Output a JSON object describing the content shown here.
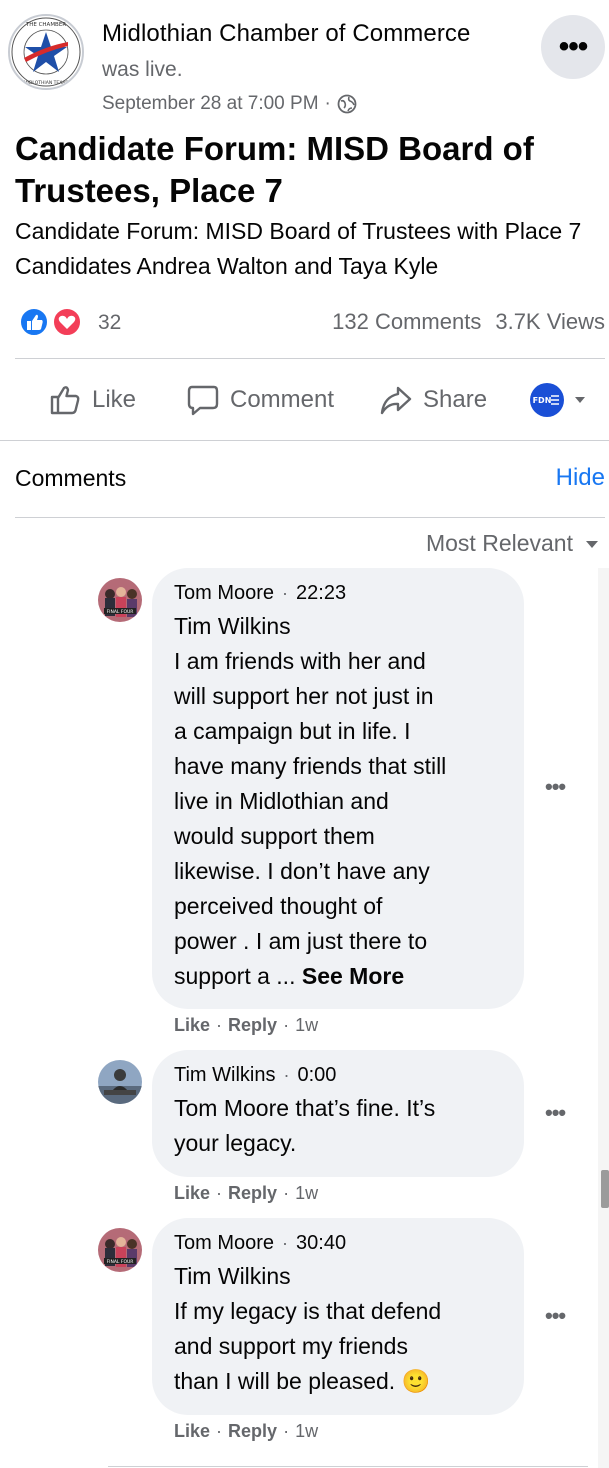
{
  "post": {
    "page_name": "Midlothian Chamber of Commerce",
    "status": "was live.",
    "date": "September 28 at 7:00 PM",
    "audience_icon": "globe-icon",
    "more_icon": "ellipsis-icon",
    "logo": {
      "alt": "chamber-logo",
      "ring_text_top": "THE CHAMBER",
      "ring_text_bottom": "MIDLOTHIAN TEXAS · SINCE 1936"
    },
    "title": "Candidate Forum: MISD Board of Trustees, Place 7",
    "description": "Candidate Forum: MISD Board of Trustees with Place 7 Candidates Andrea Walton and Taya Kyle"
  },
  "stats": {
    "reactions": [
      "like",
      "love"
    ],
    "reaction_count": "32",
    "comments": "132 Comments",
    "views": "3.7K Views"
  },
  "actions": {
    "like": "Like",
    "comment": "Comment",
    "share": "Share",
    "profile_badge": "FDN"
  },
  "comments_section": {
    "title": "Comments",
    "hide": "Hide",
    "sort": "Most Relevant"
  },
  "comments": [
    {
      "author": "Tom Moore",
      "time": "22:23",
      "mention": "Tim Wilkins",
      "lines": [
        "I am friends with her and",
        "will support her not just in",
        "a campaign but in life. I",
        "have many friends that still",
        "live in Midlothian and",
        "would support them",
        "likewise. I don’t have any",
        "perceived thought of",
        "power . I am just there to"
      ],
      "last_line": "support a ...",
      "see_more": "See More",
      "like": "Like",
      "reply": "Reply",
      "age": "1w"
    },
    {
      "author": "Tim Wilkins",
      "time": "0:00",
      "mention": "Tom Moore",
      "first_line_rest": " that’s fine. It’s",
      "second_line": "your legacy.",
      "like": "Like",
      "reply": "Reply",
      "age": "1w"
    },
    {
      "author": "Tom Moore",
      "time": "30:40",
      "mention": "Tim Wilkins",
      "lines": [
        "If my legacy is that defend",
        "and support my friends",
        "than I will be pleased. 🙂"
      ],
      "like": "Like",
      "reply": "Reply",
      "age": "1w"
    }
  ],
  "colors": {
    "link": "#1877f2",
    "secondary_text": "#65676b",
    "bubble": "#f0f2f5",
    "divider": "#ced0d4",
    "like_blue": "#1877f2",
    "love_red": "#f33e58"
  }
}
